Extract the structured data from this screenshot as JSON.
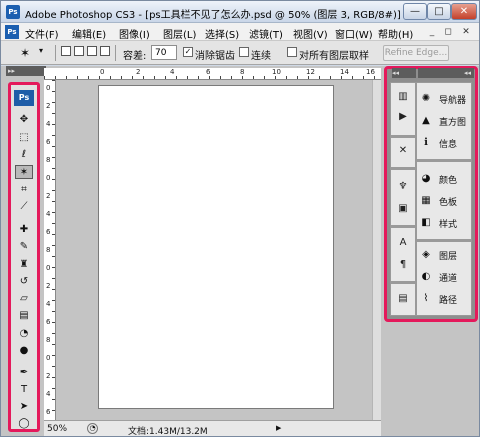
{
  "window": {
    "app_badge": "Ps",
    "title": "Adobe Photoshop CS3 - [ps工具栏不见了怎么办.psd @ 50% (图层 3, RGB/8#)]",
    "controls": {
      "minimize": "—",
      "maximize": "□",
      "close": "✕"
    }
  },
  "menubar": {
    "items": [
      "文件(F)",
      "编辑(E)",
      "图像(I)",
      "图层(L)",
      "选择(S)",
      "滤镜(T)",
      "视图(V)",
      "窗口(W)",
      "帮助(H)"
    ],
    "doc_controls": [
      "_",
      "◻",
      "✕"
    ]
  },
  "options_bar": {
    "tolerance_label": "容差:",
    "tolerance_value": "70",
    "antialias_label": "消除锯齿",
    "antialias_checked": true,
    "contiguous_label": "连续",
    "contiguous_checked": false,
    "all_layers_label": "对所有图层取样",
    "all_layers_checked": false,
    "refine_edge_label": "Refine Edge..."
  },
  "toolbox": {
    "logo": "Ps",
    "tools": [
      {
        "name": "move-tool",
        "glyph": "✥"
      },
      {
        "name": "marquee-tool",
        "glyph": "⬚"
      },
      {
        "name": "lasso-tool",
        "glyph": "ℓ"
      },
      {
        "name": "magic-wand-tool",
        "glyph": "✶"
      },
      {
        "name": "crop-tool",
        "glyph": "⌗"
      },
      {
        "name": "slice-tool",
        "glyph": "⟋"
      },
      {
        "name": "healing-brush-tool",
        "glyph": "✚"
      },
      {
        "name": "brush-tool",
        "glyph": "✎"
      },
      {
        "name": "clone-stamp-tool",
        "glyph": "♜"
      },
      {
        "name": "history-brush-tool",
        "glyph": "↺"
      },
      {
        "name": "eraser-tool",
        "glyph": "▱"
      },
      {
        "name": "gradient-tool",
        "glyph": "▤"
      },
      {
        "name": "blur-tool",
        "glyph": "◔"
      },
      {
        "name": "dodge-tool",
        "glyph": "●"
      },
      {
        "name": "pen-tool",
        "glyph": "✒"
      },
      {
        "name": "type-tool",
        "glyph": "T"
      },
      {
        "name": "path-selection-tool",
        "glyph": "➤"
      },
      {
        "name": "shape-tool",
        "glyph": "◯"
      }
    ]
  },
  "rulers": {
    "h_ticks": [
      "0",
      "2",
      "4",
      "6",
      "8",
      "10",
      "12",
      "14",
      "16"
    ],
    "v_ticks": [
      "0",
      "2",
      "4",
      "6",
      "8",
      "0",
      "2",
      "4",
      "6",
      "8",
      "0",
      "2",
      "4",
      "6",
      "8",
      "0",
      "2",
      "4",
      "6"
    ]
  },
  "statusbar": {
    "zoom": "50%",
    "doc_info": "文档:1.43M/13.2M",
    "arrow": "▶"
  },
  "right_dock": {
    "collapse_left": "◂◂",
    "collapse_right": "◂◂",
    "panels": [
      {
        "icon": "✺",
        "label": "导航器"
      },
      {
        "icon": "▲",
        "label": "直方图"
      },
      {
        "icon": "ℹ",
        "label": "信息"
      },
      {
        "icon": "◕",
        "label": "颜色"
      },
      {
        "icon": "▦",
        "label": "色板"
      },
      {
        "icon": "◧",
        "label": "样式"
      },
      {
        "icon": "◈",
        "label": "图层"
      },
      {
        "icon": "◐",
        "label": "通道"
      },
      {
        "icon": "⌇",
        "label": "路径"
      }
    ]
  }
}
